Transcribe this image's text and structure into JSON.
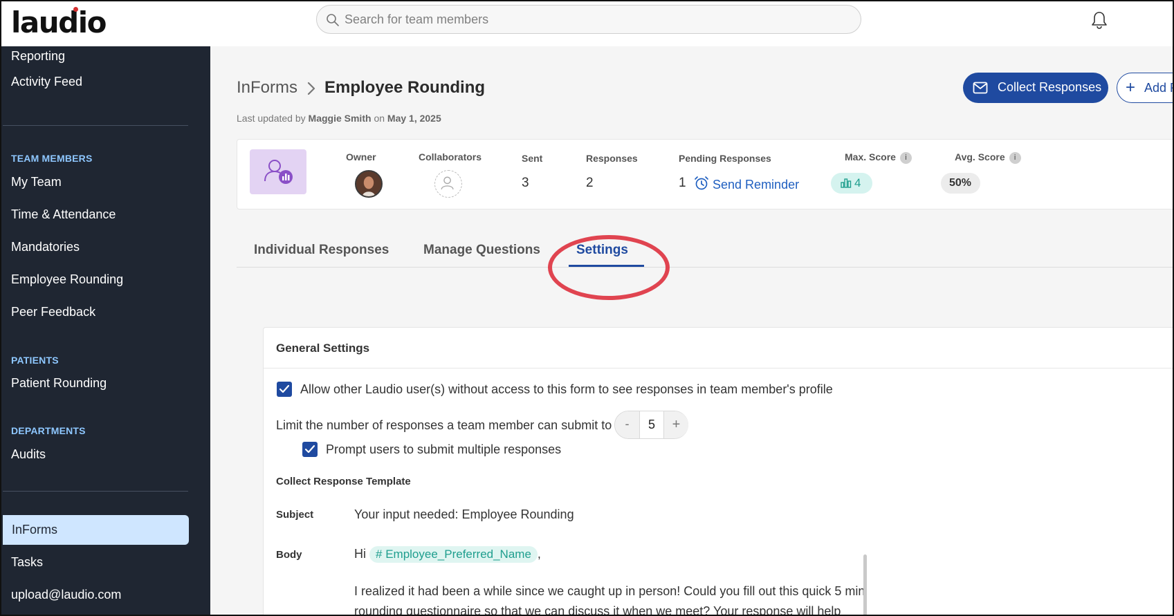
{
  "app": {
    "logo": "laudio"
  },
  "search": {
    "placeholder": "Search for team members"
  },
  "sidebar": {
    "top_items": [
      "Reporting",
      "Activity Feed"
    ],
    "sections": {
      "team_members": {
        "title": "TEAM MEMBERS",
        "items": [
          "My Team",
          "Time & Attendance",
          "Mandatories",
          "Employee Rounding",
          "Peer Feedback"
        ]
      },
      "patients": {
        "title": "PATIENTS",
        "items": [
          "Patient Rounding"
        ]
      },
      "departments": {
        "title": "DEPARTMENTS",
        "items": [
          "Audits"
        ]
      }
    },
    "bottom_items": [
      "InForms",
      "Tasks",
      "upload@laudio.com"
    ],
    "active_item": "InForms"
  },
  "header": {
    "breadcrumb_parent": "InForms",
    "title": "Employee Rounding",
    "updated_prefix": "Last updated by",
    "updated_by": "Maggie Smith",
    "updated_on_word": "on",
    "updated_date": "May 1, 2025",
    "collect_button": "Collect Responses",
    "add_button": "Add R"
  },
  "stats": {
    "owner_label": "Owner",
    "collaborators_label": "Collaborators",
    "sent_label": "Sent",
    "sent_value": "3",
    "responses_label": "Responses",
    "responses_value": "2",
    "pending_label": "Pending Responses",
    "pending_value": "1",
    "send_reminder": "Send Reminder",
    "max_score_label": "Max. Score",
    "max_score_value": "4",
    "avg_score_label": "Avg. Score",
    "avg_score_value": "50%",
    "info_glyph": "i"
  },
  "tabs": [
    {
      "label": "Individual Responses",
      "active": false
    },
    {
      "label": "Manage Questions",
      "active": false
    },
    {
      "label": "Settings",
      "active": true
    }
  ],
  "settings": {
    "heading": "General Settings",
    "allow_others": {
      "label": "Allow other Laudio user(s) without access to this form to see responses in team member's profile",
      "checked": true
    },
    "limit_label": "Limit the number of responses a team member can submit to",
    "limit_minus": "-",
    "limit_value": "5",
    "limit_plus": "+",
    "prompt_multiple": {
      "label": "Prompt users to submit multiple responses",
      "checked": true
    },
    "template_heading": "Collect Response Template",
    "subject_label": "Subject",
    "subject_value": "Your input needed: Employee Rounding",
    "body_label": "Body",
    "body_greeting": "Hi",
    "body_tag": "# Employee_Preferred_Name",
    "body_comma": ",",
    "body_line1": "I realized it had been a while since we caught up in person! Could you fill out this quick 5 min",
    "body_line2": "rounding questionnaire so that we can discuss it when we meet? Your response will help"
  },
  "colors": {
    "sidebar_bg": "#1f2632",
    "accent": "#1f4aa0",
    "section_heading": "#8ec7ff",
    "active_nav_bg": "#cfe6ff",
    "teal": "#1f9e8e",
    "annotation_ring": "#e04450"
  },
  "icons": [
    "search-icon",
    "bell-icon",
    "mail-icon",
    "plus-icon",
    "chevron-right-icon",
    "form-chart-icon",
    "user-add-icon",
    "alarm-clock-icon",
    "bar-chart-icon",
    "info-icon",
    "checkmark-icon"
  ]
}
